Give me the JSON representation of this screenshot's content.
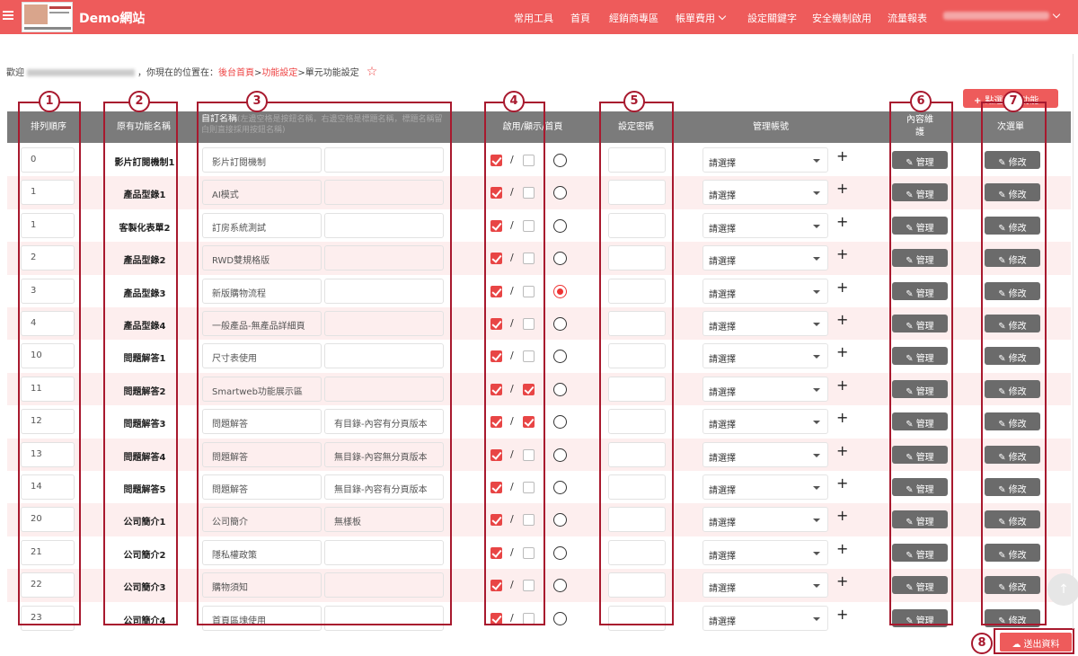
{
  "header": {
    "brand": "Demo網站",
    "nav": [
      {
        "label": "常用工具",
        "has_dropdown": false
      },
      {
        "label": "首頁",
        "has_dropdown": false
      },
      {
        "label": "經銷商專區",
        "has_dropdown": false
      },
      {
        "label": "帳單費用",
        "has_dropdown": true
      },
      {
        "label": "設定關鍵字",
        "has_dropdown": false
      },
      {
        "label": "安全機制啟用",
        "has_dropdown": false
      },
      {
        "label": "流量報表",
        "has_dropdown": false
      }
    ]
  },
  "breadcrumb": {
    "welcome": "歡迎",
    "location_prefix": "，你現在的位置在：",
    "links": [
      "後台首頁",
      "功能設定",
      "單元功能設定"
    ],
    "separator": ">"
  },
  "add_button": {
    "label": "點選新增功能"
  },
  "table": {
    "headers": {
      "order": "排列順序",
      "original_name": "原有功能名稱",
      "custom_name": "自訂名稱",
      "custom_name_hint": "(左邊空格是按鈕名稱，右邊空格是標題名稱，標題名稱留白則直接採用按鈕名稱)",
      "visibility": "啟用/顯示/首頁",
      "password": "設定密碼",
      "admin": "管理帳號",
      "content": "內容維護",
      "submenu": "次選單"
    },
    "select_placeholder": "請選擇",
    "plus": "+",
    "manage_label": "管理",
    "edit_label": "修改",
    "rows": [
      {
        "order": "0",
        "name": "影片訂閱機制1",
        "button": "影片訂閱機制",
        "title": "",
        "enabled": true,
        "shown": false,
        "home": false
      },
      {
        "order": "1",
        "name": "產品型錄1",
        "button": "AI模式",
        "title": "",
        "enabled": true,
        "shown": false,
        "home": false
      },
      {
        "order": "1",
        "name": "客製化表單2",
        "button": "訂房系統測試",
        "title": "",
        "enabled": true,
        "shown": false,
        "home": false
      },
      {
        "order": "2",
        "name": "產品型錄2",
        "button": "RWD雙規格版",
        "title": "",
        "enabled": true,
        "shown": false,
        "home": false
      },
      {
        "order": "3",
        "name": "產品型錄3",
        "button": "新版購物流程",
        "title": "",
        "enabled": true,
        "shown": false,
        "home": true
      },
      {
        "order": "4",
        "name": "產品型錄4",
        "button": "一般產品-無產品詳細頁",
        "title": "",
        "enabled": true,
        "shown": false,
        "home": false
      },
      {
        "order": "10",
        "name": "問題解答1",
        "button": "尺寸表使用",
        "title": "",
        "enabled": true,
        "shown": false,
        "home": false
      },
      {
        "order": "11",
        "name": "問題解答2",
        "button": "Smartweb功能展示區",
        "title": "",
        "enabled": true,
        "shown": true,
        "home": false
      },
      {
        "order": "12",
        "name": "問題解答3",
        "button": "問題解答",
        "title": "有目錄-內容有分頁版本",
        "enabled": true,
        "shown": true,
        "home": false
      },
      {
        "order": "13",
        "name": "問題解答4",
        "button": "問題解答",
        "title": "無目錄-內容無分頁版本",
        "enabled": true,
        "shown": false,
        "home": false
      },
      {
        "order": "14",
        "name": "問題解答5",
        "button": "問題解答",
        "title": "無目錄-內容有分頁版本",
        "enabled": true,
        "shown": false,
        "home": false
      },
      {
        "order": "20",
        "name": "公司簡介1",
        "button": "公司簡介",
        "title": "無樣板",
        "enabled": true,
        "shown": false,
        "home": false
      },
      {
        "order": "21",
        "name": "公司簡介2",
        "button": "隱私權政策",
        "title": "",
        "enabled": true,
        "shown": false,
        "home": false
      },
      {
        "order": "22",
        "name": "公司簡介3",
        "button": "購物須知",
        "title": "",
        "enabled": true,
        "shown": false,
        "home": false
      },
      {
        "order": "23",
        "name": "公司簡介4",
        "button": "首頁區塊使用",
        "title": "",
        "enabled": true,
        "shown": false,
        "home": false
      }
    ]
  },
  "annotations": [
    "1",
    "2",
    "3",
    "4",
    "5",
    "6",
    "7",
    "8"
  ],
  "submit_button": {
    "label": "送出資料"
  },
  "colors": {
    "accent": "#ee5b5b",
    "annotation": "#a8192e",
    "header_bg": "#7b7b7b",
    "alt_row": "#fdeeee"
  }
}
